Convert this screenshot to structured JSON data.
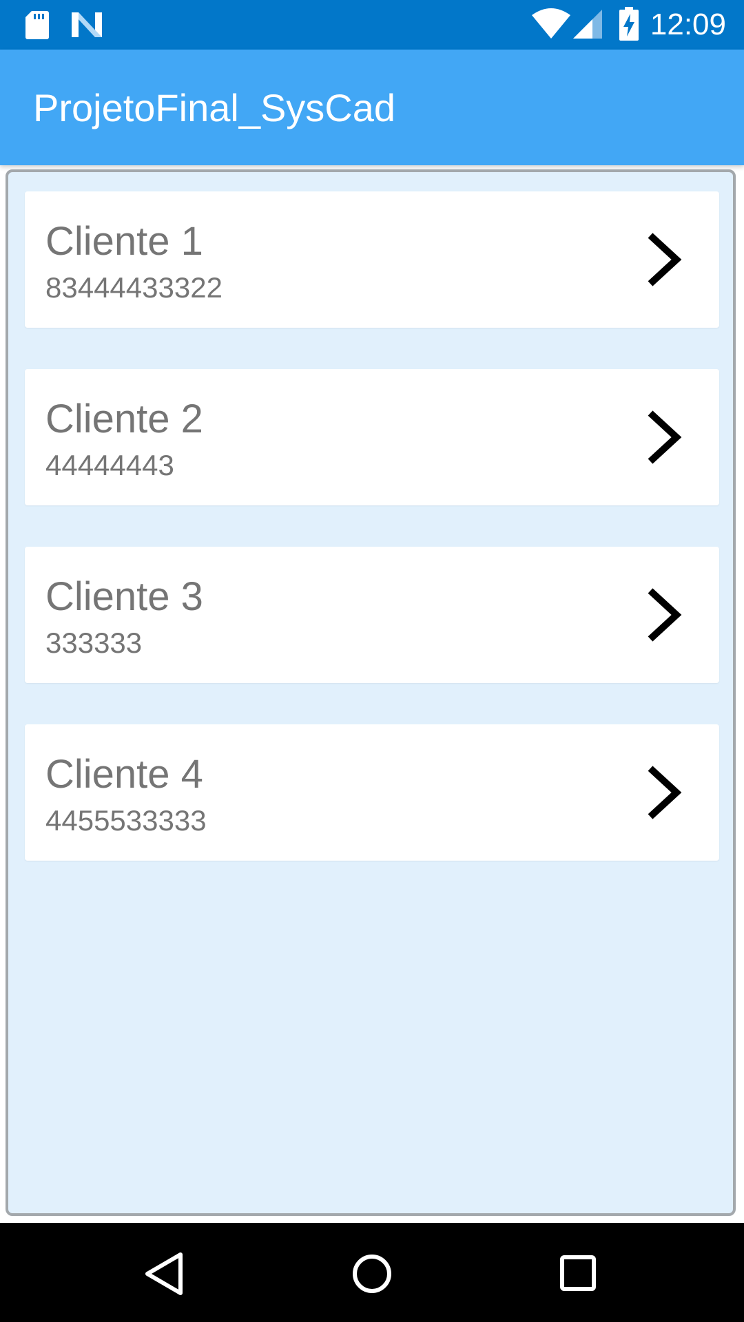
{
  "status_bar": {
    "time": "12:09",
    "icons": [
      "sd-card-icon",
      "n-icon",
      "wifi-icon",
      "signal-icon",
      "battery-charging-icon"
    ],
    "color": "#0277c9"
  },
  "app_bar": {
    "title": "ProjetoFinal_SysCad",
    "color": "#42a7f5"
  },
  "list": {
    "background": "#e1f0fc",
    "items": [
      {
        "name": "Cliente 1",
        "phone": "83444433322",
        "icon": "chevron-right-icon"
      },
      {
        "name": "Cliente 2",
        "phone": "44444443",
        "icon": "chevron-right-icon"
      },
      {
        "name": "Cliente 3",
        "phone": "333333",
        "icon": "chevron-right-icon"
      },
      {
        "name": "Cliente 4",
        "phone": "4455533333",
        "icon": "chevron-right-icon"
      }
    ]
  },
  "nav_bar": {
    "buttons": [
      "back-icon",
      "home-icon",
      "recents-icon"
    ]
  }
}
